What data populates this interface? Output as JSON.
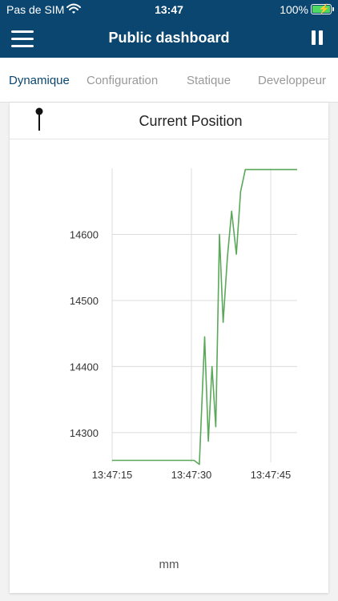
{
  "status_bar": {
    "carrier": "Pas de SIM",
    "time": "13:47",
    "battery": "100%"
  },
  "header": {
    "title": "Public dashboard"
  },
  "tabs": [
    {
      "label": "Dynamique",
      "active": true
    },
    {
      "label": "Configuration",
      "active": false
    },
    {
      "label": "Statique",
      "active": false
    },
    {
      "label": "Developpeur",
      "active": false
    }
  ],
  "card": {
    "title": "Current Position",
    "icon": "pin-icon"
  },
  "colors": {
    "header": "#0a4670",
    "accent": "#0a4670",
    "line": "#5aa85a",
    "battery": "#4cd964"
  },
  "chart_data": {
    "type": "line",
    "xlabel": "mm",
    "ylabel": "",
    "x_ticks": [
      "13:47:15",
      "13:47:30",
      "13:47:45"
    ],
    "x_tick_seconds": [
      15,
      30,
      45
    ],
    "y_ticks": [
      14300,
      14400,
      14500,
      14600
    ],
    "xlim": [
      15,
      50
    ],
    "ylim": [
      14255,
      14700
    ],
    "grid": true,
    "series": [
      {
        "x": [
          15,
          29.5,
          30.5,
          31.5,
          32.5,
          33.2,
          33.9,
          34.6,
          35.3,
          36.0,
          36.8,
          37.6,
          38.5,
          39.3,
          40.2,
          41.0,
          50
        ],
        "y": [
          14258,
          14258,
          14258,
          14252,
          14445,
          14287,
          14400,
          14309,
          14600,
          14467,
          14565,
          14635,
          14570,
          14665,
          14698,
          14698,
          14698
        ]
      }
    ]
  }
}
